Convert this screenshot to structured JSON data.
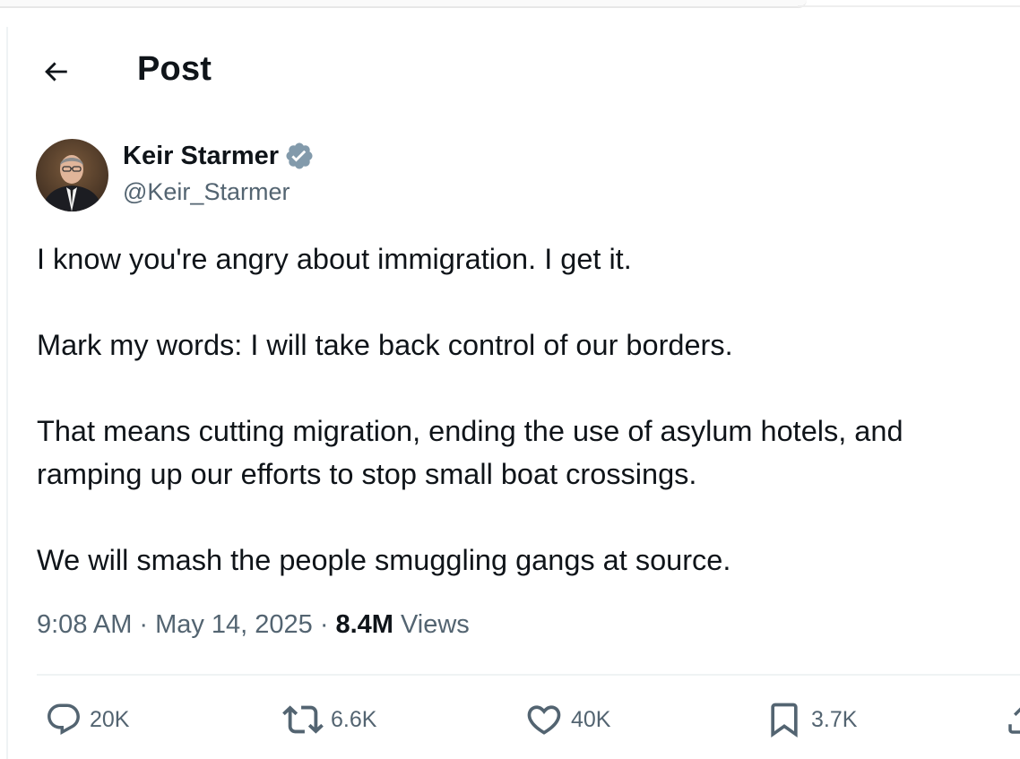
{
  "header": {
    "title": "Post",
    "back_icon": "arrow-left-icon"
  },
  "author": {
    "display_name": "Keir Starmer",
    "handle": "@Keir_Starmer",
    "verified_icon": "verified-badge-icon",
    "verified_color": "#829aab"
  },
  "tweet": {
    "paragraphs": [
      "I know you're angry about immigration. I get it.",
      "Mark my words: I will take back control of our borders.",
      "That means cutting migration, ending the use of asylum hotels, and",
      "ramping up our efforts to stop small boat crossings.",
      "We will smash the people smuggling gangs at source."
    ]
  },
  "meta": {
    "time": "9:08 AM",
    "separator": "·",
    "date": "May 14, 2025",
    "views_count": "8.4M",
    "views_label": "Views"
  },
  "actions": {
    "replies": "20K",
    "reposts": "6.6K",
    "likes": "40K",
    "bookmarks": "3.7K"
  },
  "colors": {
    "text_primary": "#0f1419",
    "text_secondary": "#536471",
    "divider": "#eff3f4"
  }
}
